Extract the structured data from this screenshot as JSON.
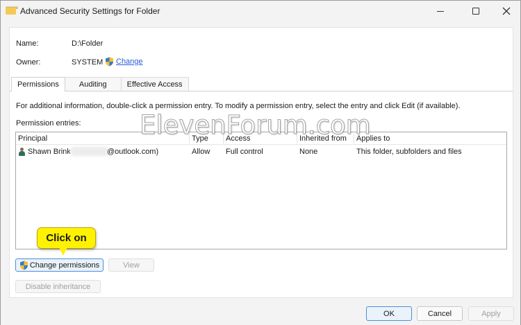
{
  "window": {
    "title": "Advanced Security Settings for Folder"
  },
  "fields": {
    "name_label": "Name:",
    "name_value": "D:\\Folder",
    "owner_label": "Owner:",
    "owner_value": "SYSTEM",
    "owner_change": "Change"
  },
  "tabs": [
    {
      "label": "Permissions",
      "active": true
    },
    {
      "label": "Auditing",
      "active": false
    },
    {
      "label": "Effective Access",
      "active": false
    }
  ],
  "info_text": "For additional information, double-click a permission entry. To modify a permission entry, select the entry and click Edit (if available).",
  "entries_label": "Permission entries:",
  "columns": [
    "Principal",
    "Type",
    "Access",
    "Inherited from",
    "Applies to"
  ],
  "rows": [
    {
      "principal_name": "Shawn Brink",
      "principal_email": "@outlook.com)",
      "type": "Allow",
      "access": "Full control",
      "inherited_from": "None",
      "applies_to": "This folder, subfolders and files"
    }
  ],
  "buttons": {
    "change_permissions": "Change permissions",
    "view": "View",
    "disable_inheritance": "Disable inheritance",
    "ok": "OK",
    "cancel": "Cancel",
    "apply": "Apply"
  },
  "callout": "Click on",
  "watermark": "ElevenForum.com",
  "colors": {
    "accent": "#4a8fd9",
    "link": "#2a5bd7",
    "callout": "#fff200"
  }
}
